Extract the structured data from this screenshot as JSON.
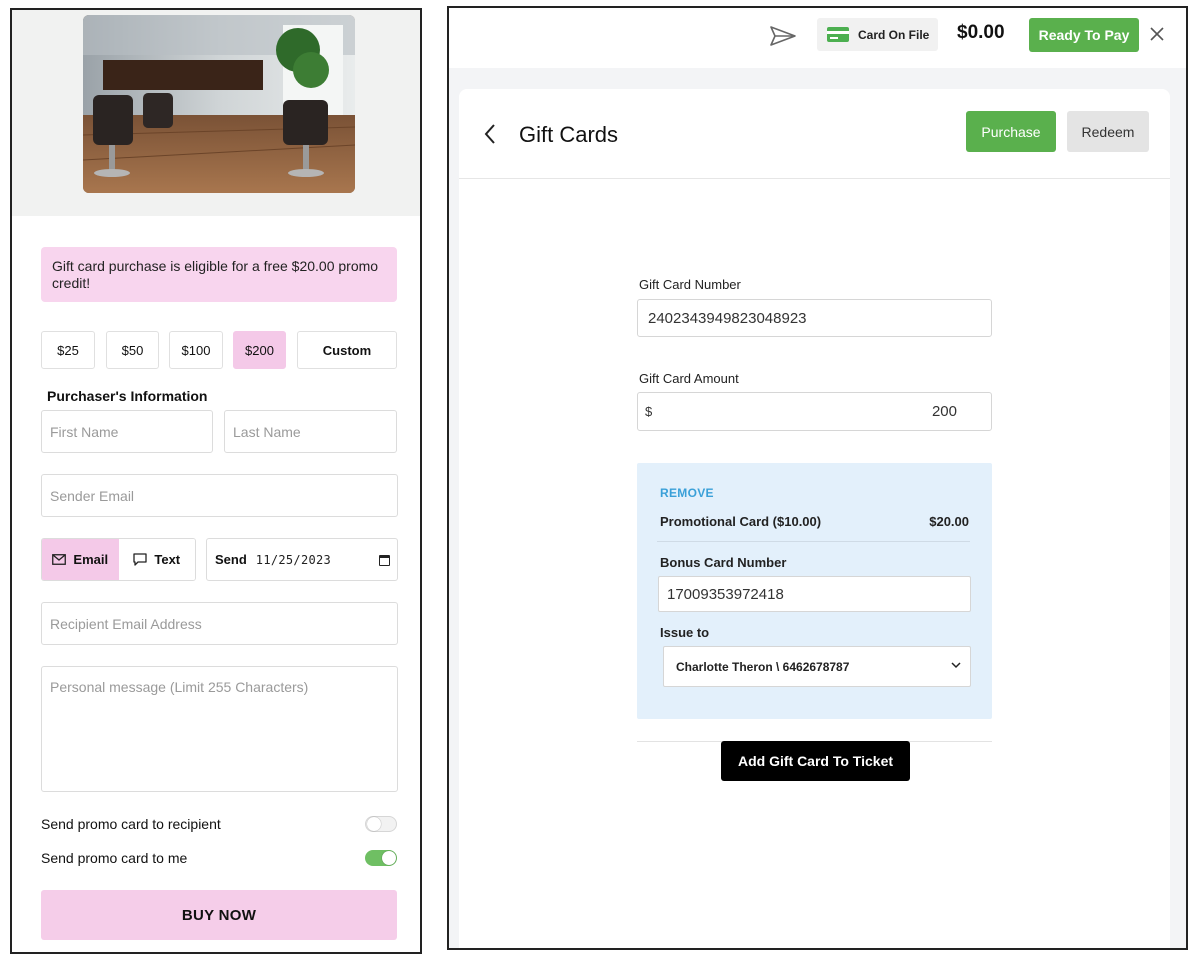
{
  "left": {
    "promo_banner": "Gift card purchase is eligible for a free $20.00 promo credit!",
    "amounts": [
      "$25",
      "$50",
      "$100",
      "$200",
      "Custom"
    ],
    "selected_amount": "$200",
    "purchaser_section": "Purchaser's Information",
    "first_name_placeholder": "First Name",
    "last_name_placeholder": "Last Name",
    "sender_email_placeholder": "Sender Email",
    "delivery_options": [
      "Email",
      "Text"
    ],
    "selected_delivery": "Email",
    "send_label": "Send",
    "send_date": "11/25/2023",
    "recipient_email_placeholder": "Recipient Email Address",
    "message_placeholder": "Personal message (Limit 255 Characters)",
    "toggles": [
      {
        "label": "Send promo card to recipient",
        "on": false
      },
      {
        "label": "Send promo card to me",
        "on": true
      }
    ],
    "buy_now": "BUY NOW",
    "colors": {
      "pink": "#f4c9e8",
      "banner": "#f8d5ee",
      "green": "#6fbf63"
    }
  },
  "right": {
    "topbar": {
      "card_on_file": "Card On File",
      "balance": "$0.00",
      "ready_to_pay": "Ready To Pay"
    },
    "title": "Gift Cards",
    "purchase_label": "Purchase",
    "redeem_label": "Redeem",
    "gift_card_number_label": "Gift Card Number",
    "gift_card_number": "2402343949823048923",
    "gift_card_amount_label": "Gift Card Amount",
    "currency_symbol": "$",
    "gift_card_amount": "200",
    "bonus": {
      "remove": "REMOVE",
      "promo_name": "Promotional Card ($10.00)",
      "promo_value": "$20.00",
      "bonus_number_label": "Bonus Card Number",
      "bonus_number": "17009353972418",
      "issue_to_label": "Issue to",
      "issue_to": "Charlotte Theron \\ 6462678787"
    },
    "add_button": "Add Gift Card To Ticket",
    "colors": {
      "green": "#5ab04d",
      "bonus_bg": "#e3f0fb",
      "link": "#3aa0d8"
    }
  }
}
